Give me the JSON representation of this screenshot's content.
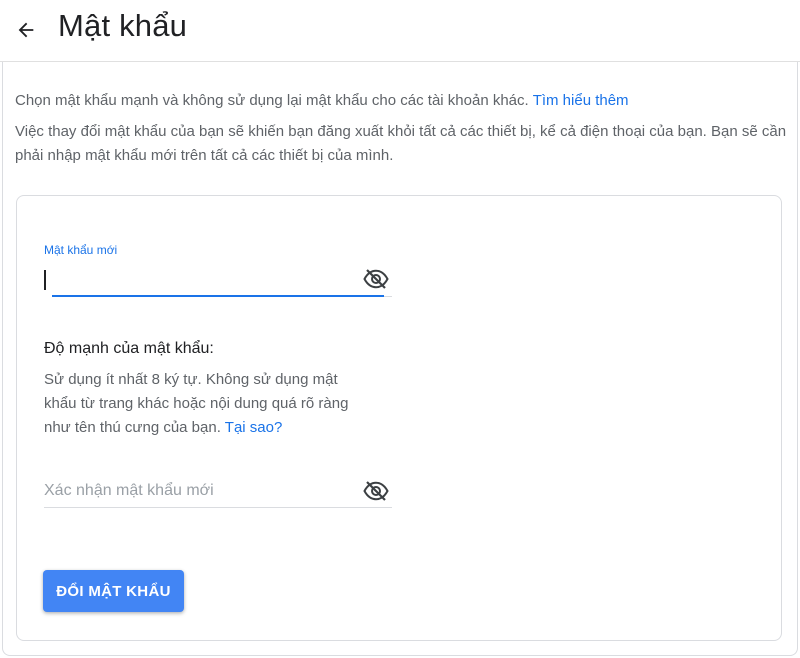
{
  "header": {
    "title": "Mật khẩu",
    "back_icon": "arrow-back-icon"
  },
  "intro": {
    "text": "Chọn mật khẩu mạnh và không sử dụng lại mật khẩu cho các tài khoản khác.",
    "link": "Tìm hiểu thêm"
  },
  "notice": "Việc thay đổi mật khẩu của bạn sẽ khiến bạn đăng xuất khỏi tất cả các thiết bị, kể cả điện thoại của bạn. Bạn sẽ cần phải nhập mật khẩu mới trên tất cả các thiết bị của mình.",
  "new_password": {
    "label": "Mật khẩu mới",
    "value": "",
    "visibility_icon": "eye-off-icon"
  },
  "strength": {
    "title": "Độ mạnh của mật khẩu:",
    "text": "Sử dụng ít nhất 8 ký tự. Không sử dụng mật khẩu từ trang khác hoặc nội dung quá rõ ràng như tên thú cưng của bạn.",
    "link": "Tại sao?"
  },
  "confirm_password": {
    "placeholder": "Xác nhận mật khẩu mới",
    "value": "",
    "visibility_icon": "eye-off-icon"
  },
  "submit": {
    "label": "ĐỔI MẬT KHẨU"
  },
  "colors": {
    "accent": "#1a73e8",
    "button": "#4285f4",
    "secondary_text": "#5f6368",
    "border": "#dadce0"
  }
}
